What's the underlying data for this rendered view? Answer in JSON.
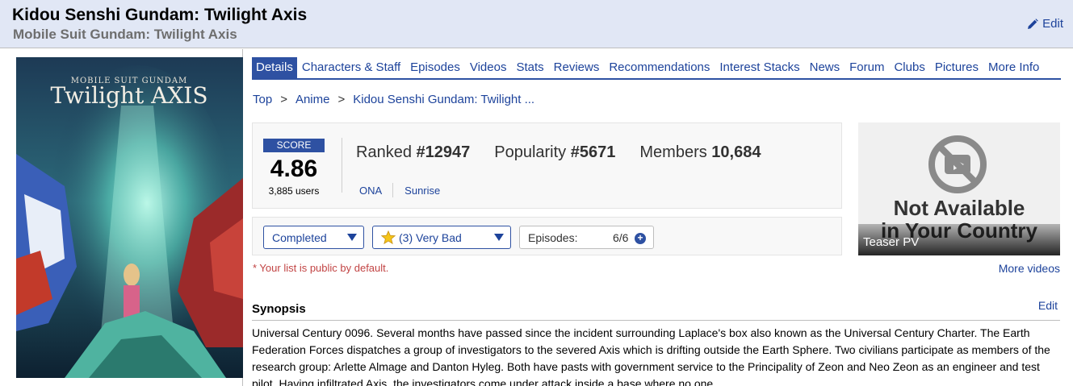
{
  "header": {
    "title": "Kidou Senshi Gundam: Twilight Axis",
    "english_title": "Mobile Suit Gundam: Twilight Axis",
    "edit_label": "Edit"
  },
  "cover": {
    "alt": "Mobile Suit Gundam Twilight AXIS",
    "line1": "MOBILE SUIT GUNDAM",
    "line2": "Twilight AXIS"
  },
  "nav": {
    "tabs": [
      "Details",
      "Characters & Staff",
      "Episodes",
      "Videos",
      "Stats",
      "Reviews",
      "Recommendations",
      "Interest Stacks",
      "News",
      "Forum",
      "Clubs",
      "Pictures",
      "More Info"
    ],
    "active": "Details"
  },
  "breadcrumb": {
    "items": [
      "Top",
      "Anime",
      "Kidou Senshi Gundam: Twilight ..."
    ],
    "separator": ">"
  },
  "score": {
    "label": "SCORE",
    "value": "4.86",
    "users": "3,885 users"
  },
  "stats": {
    "ranked_label": "Ranked",
    "ranked_value": "#12947",
    "popularity_label": "Popularity",
    "popularity_value": "#5671",
    "members_label": "Members",
    "members_value": "10,684"
  },
  "meta": {
    "type": "ONA",
    "studio": "Sunrise"
  },
  "list": {
    "status": "Completed",
    "score": "(3) Very Bad",
    "episodes_label": "Episodes:",
    "episodes_value": "6/6",
    "plus": "+",
    "public_note": "* Your list is public by default."
  },
  "video": {
    "message_line1": "Not Available",
    "message_line2": "in Your Country",
    "caption": "Teaser PV",
    "more": "More videos"
  },
  "synopsis": {
    "title": "Synopsis",
    "edit": "Edit",
    "text": "Universal Century 0096. Several months have passed since the incident surrounding Laplace's box also known as the Universal Century Charter. The Earth Federation Forces dispatches a group of investigators to the severed Axis which is drifting outside the Earth Sphere. Two civilians participate as members of the research group: Arlette Almage and Danton Hyleg. Both have pasts with government service to the Principality of Zeon and Neo Zeon as an engineer and test pilot. Having infiltrated Axis, the investigators come under attack inside a base where no one"
  },
  "colors": {
    "brand": "#2e51a2",
    "link": "#1d439b",
    "header_bg": "#e1e7f5",
    "note_red": "#c24444"
  }
}
